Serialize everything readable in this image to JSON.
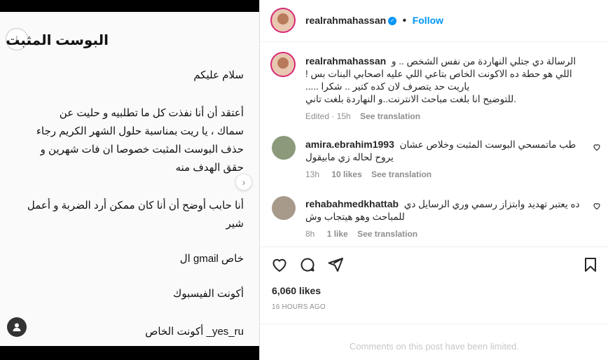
{
  "post_image": {
    "title": "البوست المثبت",
    "lines": [
      "سلام عليكم",
      "أعتقد أن أنا نفذت كل ما تطلبيه و حليت عن",
      "سماك ، يا ريت بمناسبة حلول  الشهر الكريم رجاء",
      "حذف البوست المثبت خصوصا ان فات شهرين و",
      "حقق الهدف منه",
      "أنا حابب أوضح أن أنا كان ممكن أرد الضربة و أعمل",
      "شير",
      "خاص gmail ال",
      "أكونت الفيسبوك",
      "yes_ru_ أكونت الخاص"
    ]
  },
  "header": {
    "username": "realrahmahassan",
    "dot": "•",
    "follow_label": "Follow"
  },
  "caption": {
    "username": "realrahmahassan",
    "text_line1": "الرسالة دي جتلي النهاردة من نفس الشخص .. و",
    "text_line2": "اللي هو حطة ده الاكونت الخاص بتاعي اللي عليه اصحابي البنات بس !",
    "text_line3": "..... ياريت حد يتصرف لان كده كتير .. شكرا",
    "text_line4": "للتوضيح انا بلغت مباحث الانترنت..و النهاردة بلغت تاني.",
    "edited": "Edited · 15h",
    "see_translation": "See translation"
  },
  "comments": [
    {
      "username": "amira.ebrahim1993",
      "text": "طب ماتمسحي البوست المثبت وخلاص عشان",
      "text2": "يروح لحاله زي مابيقول",
      "time": "13h",
      "likes": "10 likes",
      "see_translation": "See translation"
    },
    {
      "username": "rehabahmedkhattab",
      "text": "ده يعتبر تهديد وابتزاز رسمي وري الرسايل دي",
      "text2": "للمباحث وهو هيتجاب وش",
      "time": "8h",
      "likes": "1 like",
      "see_translation": "See translation"
    }
  ],
  "likes_count": "6,060 likes",
  "post_time": "16 HOURS AGO",
  "footer_notice": "Comments on this post have been limited.",
  "icons": {
    "heart": "heart-icon",
    "comment": "comment-icon",
    "share": "share-icon",
    "save": "bookmark-icon",
    "verified": "verified-badge-icon",
    "next": "chevron-right-icon",
    "user_tag": "user-tag-icon"
  },
  "colors": {
    "accent": "#0095f6",
    "secondary_text": "#8e8e8e",
    "border": "#efefef"
  }
}
